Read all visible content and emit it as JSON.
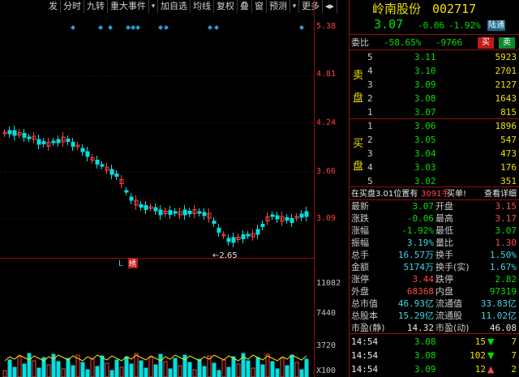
{
  "toolbar": {
    "items": [
      "发",
      "分时",
      "九转",
      "重大事件",
      "",
      "加自选",
      "均线",
      "复权",
      "叠",
      "窗",
      "预测",
      "",
      "更多"
    ],
    "nav_icon": "◂▸"
  },
  "stock": {
    "name": "岭南股份",
    "code": "002717",
    "price": "3.07",
    "change": "-0.06",
    "change_pct": "-1.92%",
    "tag": "陆通"
  },
  "weibi": {
    "label": "委比",
    "ratio": "-58.65%",
    "diff": "-9766",
    "buy_btn": "买",
    "sell_btn": "卖"
  },
  "sell_side_label": [
    "卖",
    "盘"
  ],
  "buy_side_label": [
    "买",
    "盘"
  ],
  "asks": [
    {
      "level": "5",
      "price": "3.11",
      "vol": "5923"
    },
    {
      "level": "4",
      "price": "3.10",
      "vol": "2701"
    },
    {
      "level": "3",
      "price": "3.09",
      "vol": "2127"
    },
    {
      "level": "2",
      "price": "3.08",
      "vol": "1643"
    },
    {
      "level": "1",
      "price": "3.07",
      "vol": "815"
    }
  ],
  "bids": [
    {
      "level": "1",
      "price": "3.06",
      "vol": "1896"
    },
    {
      "level": "2",
      "price": "3.05",
      "vol": "547"
    },
    {
      "level": "3",
      "price": "3.04",
      "vol": "473"
    },
    {
      "level": "4",
      "price": "3.03",
      "vol": "176"
    },
    {
      "level": "5",
      "price": "3.02",
      "vol": "351"
    }
  ],
  "notice": {
    "prefix": "在买盘3.01位置有",
    "amount": "3091手",
    "suffix": "买单!",
    "link": "查看详细"
  },
  "stats": [
    {
      "l1": "最新",
      "v1": "3.07",
      "c1": "green",
      "l2": "开盘",
      "v2": "3.15",
      "c2": "red"
    },
    {
      "l1": "涨跌",
      "v1": "-0.06",
      "c1": "green",
      "l2": "最高",
      "v2": "3.17",
      "c2": "red"
    },
    {
      "l1": "涨幅",
      "v1": "-1.92%",
      "c1": "green",
      "l2": "最低",
      "v2": "3.07",
      "c2": "green"
    },
    {
      "l1": "振幅",
      "v1": "3.19%",
      "c1": "cyan",
      "l2": "量比",
      "v2": "1.30",
      "c2": "red"
    },
    {
      "l1": "总手",
      "v1": "16.57万",
      "c1": "cyan",
      "l2": "换手",
      "v2": "1.50%",
      "c2": "cyan"
    },
    {
      "l1": "金额",
      "v1": "5174万",
      "c1": "cyan",
      "l2": "换手(实)",
      "v2": "1.67%",
      "c2": "cyan"
    },
    {
      "l1": "涨停",
      "v1": "3.44",
      "c1": "red",
      "l2": "跌停",
      "v2": "2.82",
      "c2": "green"
    },
    {
      "l1": "外盘",
      "v1": "68368",
      "c1": "red",
      "l2": "内盘",
      "v2": "97319",
      "c2": "green"
    },
    {
      "l1": "总市值",
      "v1": "46.93亿",
      "c1": "cyan",
      "l2": "流通值",
      "v2": "33.83亿",
      "c2": "cyan"
    },
    {
      "l1": "总股本",
      "v1": "15.29亿",
      "c1": "cyan",
      "l2": "流通股",
      "v2": "11.02亿",
      "c2": "cyan"
    },
    {
      "l1": "市盈(静)",
      "v1": "14.32",
      "c1": "white",
      "l2": "市盈(动)",
      "v2": "46.08",
      "c2": "white"
    }
  ],
  "ticks": [
    {
      "time": "14:54",
      "price": "3.08",
      "vol": "15",
      "dir": "down",
      "n": "7"
    },
    {
      "time": "14:54",
      "price": "3.08",
      "vol": "102",
      "dir": "down",
      "n": "7"
    },
    {
      "time": "14:54",
      "price": "3.09",
      "vol": "12",
      "dir": "up",
      "n": "2"
    }
  ],
  "price_axis": [
    "5.38",
    "4.81",
    "4.24",
    "3.66",
    "3.09"
  ],
  "volume_axis": [
    "11082",
    "7440",
    "3720",
    "X100"
  ],
  "chart_labels": {
    "low_label": "2.65",
    "l_marker": "L",
    "badge": "绣"
  },
  "colors": {
    "up": "#ff4040",
    "down": "#00e0e0",
    "event": "#2a9cd8"
  }
}
